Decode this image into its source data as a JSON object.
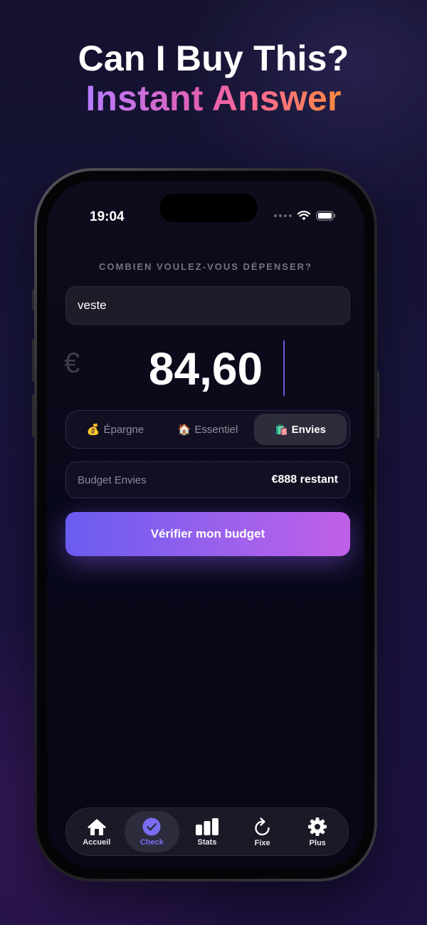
{
  "promo": {
    "headline_1": "Can I Buy This?",
    "headline_2": "Instant Answer"
  },
  "status_bar": {
    "time": "19:04",
    "icons": [
      "signal-icon",
      "wifi-icon",
      "battery-icon"
    ]
  },
  "main": {
    "question": "COMBIEN VOULEZ-VOUS DÉPENSER?",
    "item_field": {
      "value": "veste"
    },
    "currency_symbol": "€",
    "amount": "84,60",
    "categories": [
      {
        "emoji": "💰",
        "label": "Épargne",
        "selected": false
      },
      {
        "emoji": "🏠",
        "label": "Essentiel",
        "selected": false
      },
      {
        "emoji": "🛍️",
        "label": "Envies",
        "selected": true
      }
    ],
    "budget": {
      "label": "Budget Envies",
      "remaining": "€888 restant"
    },
    "cta_label": "Vérifier mon budget"
  },
  "tab_bar": {
    "items": [
      {
        "label": "Accueil",
        "icon": "home-icon",
        "active": false
      },
      {
        "label": "Check",
        "icon": "check-circle-icon",
        "active": true
      },
      {
        "label": "Stats",
        "icon": "bar-chart-icon",
        "active": false
      },
      {
        "label": "Fixe",
        "icon": "refresh-icon",
        "active": false
      },
      {
        "label": "Plus",
        "icon": "gear-icon",
        "active": false
      }
    ]
  },
  "colors": {
    "accent": "#7a6df3",
    "cta_gradient_start": "#6a5cf0",
    "cta_gradient_end": "#c160e8",
    "headline_gradient": [
      "#b67cff",
      "#e25fb4",
      "#ff8a3d"
    ]
  }
}
